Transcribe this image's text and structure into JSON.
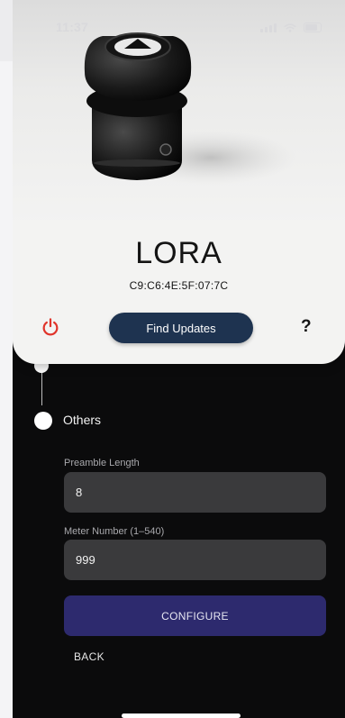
{
  "status_bar": {
    "time": "11:37"
  },
  "device": {
    "name": "LORA",
    "mac_address": "C9:C6:4E:5F:07:7C"
  },
  "actions": {
    "find_updates_label": "Find Updates",
    "help_label": "?"
  },
  "steps": [
    {
      "label": "Others"
    }
  ],
  "form": {
    "preamble_length": {
      "label": "Preamble Length",
      "value": "8"
    },
    "meter_number": {
      "label": "Meter Number (1–540)",
      "value": "999"
    },
    "configure_label": "CONFIGURE",
    "back_label": "BACK"
  },
  "colors": {
    "power_icon": "#e0342b",
    "find_updates_bg": "#1e3350",
    "configure_bg": "#2d2a6e",
    "input_bg": "#3a3a3c"
  }
}
